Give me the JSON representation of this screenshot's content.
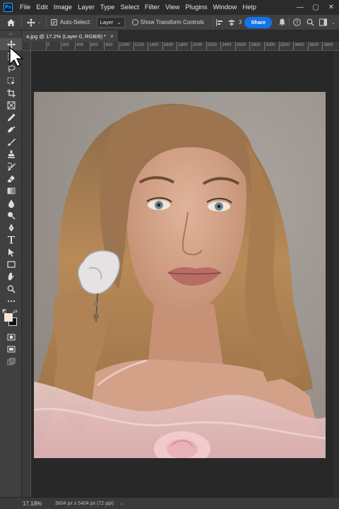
{
  "menubar": {
    "logo": "Ps",
    "items": [
      "File",
      "Edit",
      "Image",
      "Layer",
      "Type",
      "Select",
      "Filter",
      "View",
      "Plugins",
      "Window",
      "Help"
    ],
    "controls": {
      "minimize": "—",
      "restore": "▢",
      "close": "✕"
    }
  },
  "optionsbar": {
    "auto_select_label": "Auto-Select:",
    "auto_select_value": "Layer",
    "transform_controls_label": "Show Transform Controls",
    "extra_label": "3",
    "share_label": "Share"
  },
  "document": {
    "tab_title": "a.jpg @ 17.2% (Layer 0, RGB/8) *",
    "close": "×"
  },
  "ruler": {
    "top_ticks": [
      "0",
      "200",
      "400",
      "600",
      "800",
      "1000",
      "1200",
      "1400",
      "1600",
      "1800",
      "2000",
      "2200",
      "2400",
      "2600",
      "2800",
      "3000",
      "3200",
      "3400",
      "3600",
      "3800"
    ]
  },
  "status": {
    "zoom": "17.18%",
    "doc_info": "3604 px x 5404 px (72 ppi)",
    "arrow": "›"
  },
  "colors": {
    "foreground": "#f7e6d6",
    "background": "#111111",
    "accent": "#1473e6"
  },
  "tools": [
    "move-tool",
    "marquee-tool",
    "lasso-tool",
    "object-selection-tool",
    "crop-tool",
    "frame-tool",
    "eyedropper-tool",
    "spot-healing-tool",
    "brush-tool",
    "clone-stamp-tool",
    "history-brush-tool",
    "eraser-tool",
    "gradient-tool",
    "blur-tool",
    "dodge-tool",
    "pen-tool",
    "type-tool",
    "path-selection-tool",
    "rectangle-tool",
    "hand-tool",
    "zoom-tool",
    "more-tools"
  ]
}
